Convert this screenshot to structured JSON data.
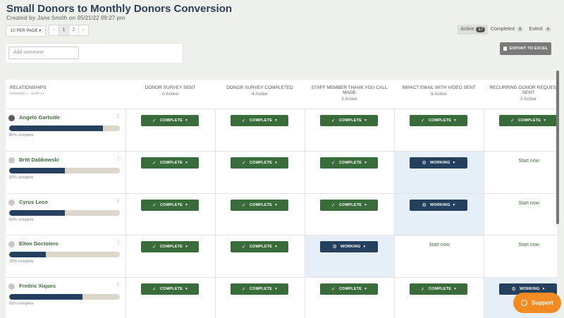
{
  "header": {
    "title": "Small Donors to Monthly Donors Conversion",
    "subtitle": "Created by Jane Smith on 05/21/22 09:27 pm"
  },
  "toolbar": {
    "per_page": "10 PER PAGE ▾",
    "pages": [
      "‹",
      "1",
      "2",
      "›"
    ],
    "export_label": "EXPORT TO EXCEL"
  },
  "filters": [
    {
      "label": "Active",
      "count": "17"
    },
    {
      "label": "Completed",
      "count": "9"
    },
    {
      "label": "Exited",
      "count": "4"
    }
  ],
  "add_placeholder": "Add someone",
  "relationships": {
    "title": "RELATIONSHIPS",
    "showing": "SHOWING 1 - 10 OF 17"
  },
  "columns": [
    {
      "title": "DONOR SURVEY SENT",
      "active": "0 Active"
    },
    {
      "title": "DONOR SURVEY COMPLETED",
      "active": "4 Active"
    },
    {
      "title": "STAFF MEMBER THANK YOU CALL MADE",
      "active": "3 Active"
    },
    {
      "title": "IMPACT EMAIL WITH VIDEO SENT",
      "active": "6 Active"
    },
    {
      "title": "RECURRING DONOR REQUEST EM SENT",
      "active": "2 Active"
    }
  ],
  "labels": {
    "complete": "COMPLETE",
    "working": "WORKING",
    "start_now": "Start now",
    "support": "Support"
  },
  "rows": [
    {
      "name": "Angelo Gartside",
      "progress": 0.85,
      "pct": "85% complete",
      "photo": true,
      "cells": [
        "complete",
        "complete",
        "complete",
        "complete",
        "complete"
      ]
    },
    {
      "name": "Britt Dabkowski",
      "progress": 0.5,
      "pct": "50% complete",
      "photo": false,
      "cells": [
        "complete",
        "complete",
        "complete",
        "working",
        "start"
      ]
    },
    {
      "name": "Cyrus Leco",
      "progress": 0.5,
      "pct": "50% complete",
      "photo": false,
      "cells": [
        "complete",
        "complete",
        "complete",
        "working",
        "start"
      ]
    },
    {
      "name": "Elton Doctolero",
      "progress": 0.33,
      "pct": "33% complete",
      "photo": false,
      "cells": [
        "complete",
        "complete",
        "working",
        "start",
        "start"
      ]
    },
    {
      "name": "Fredric Xiques",
      "progress": 0.66,
      "pct": "66% complete",
      "photo": false,
      "cells": [
        "complete",
        "complete",
        "complete",
        "complete",
        "working"
      ]
    }
  ]
}
